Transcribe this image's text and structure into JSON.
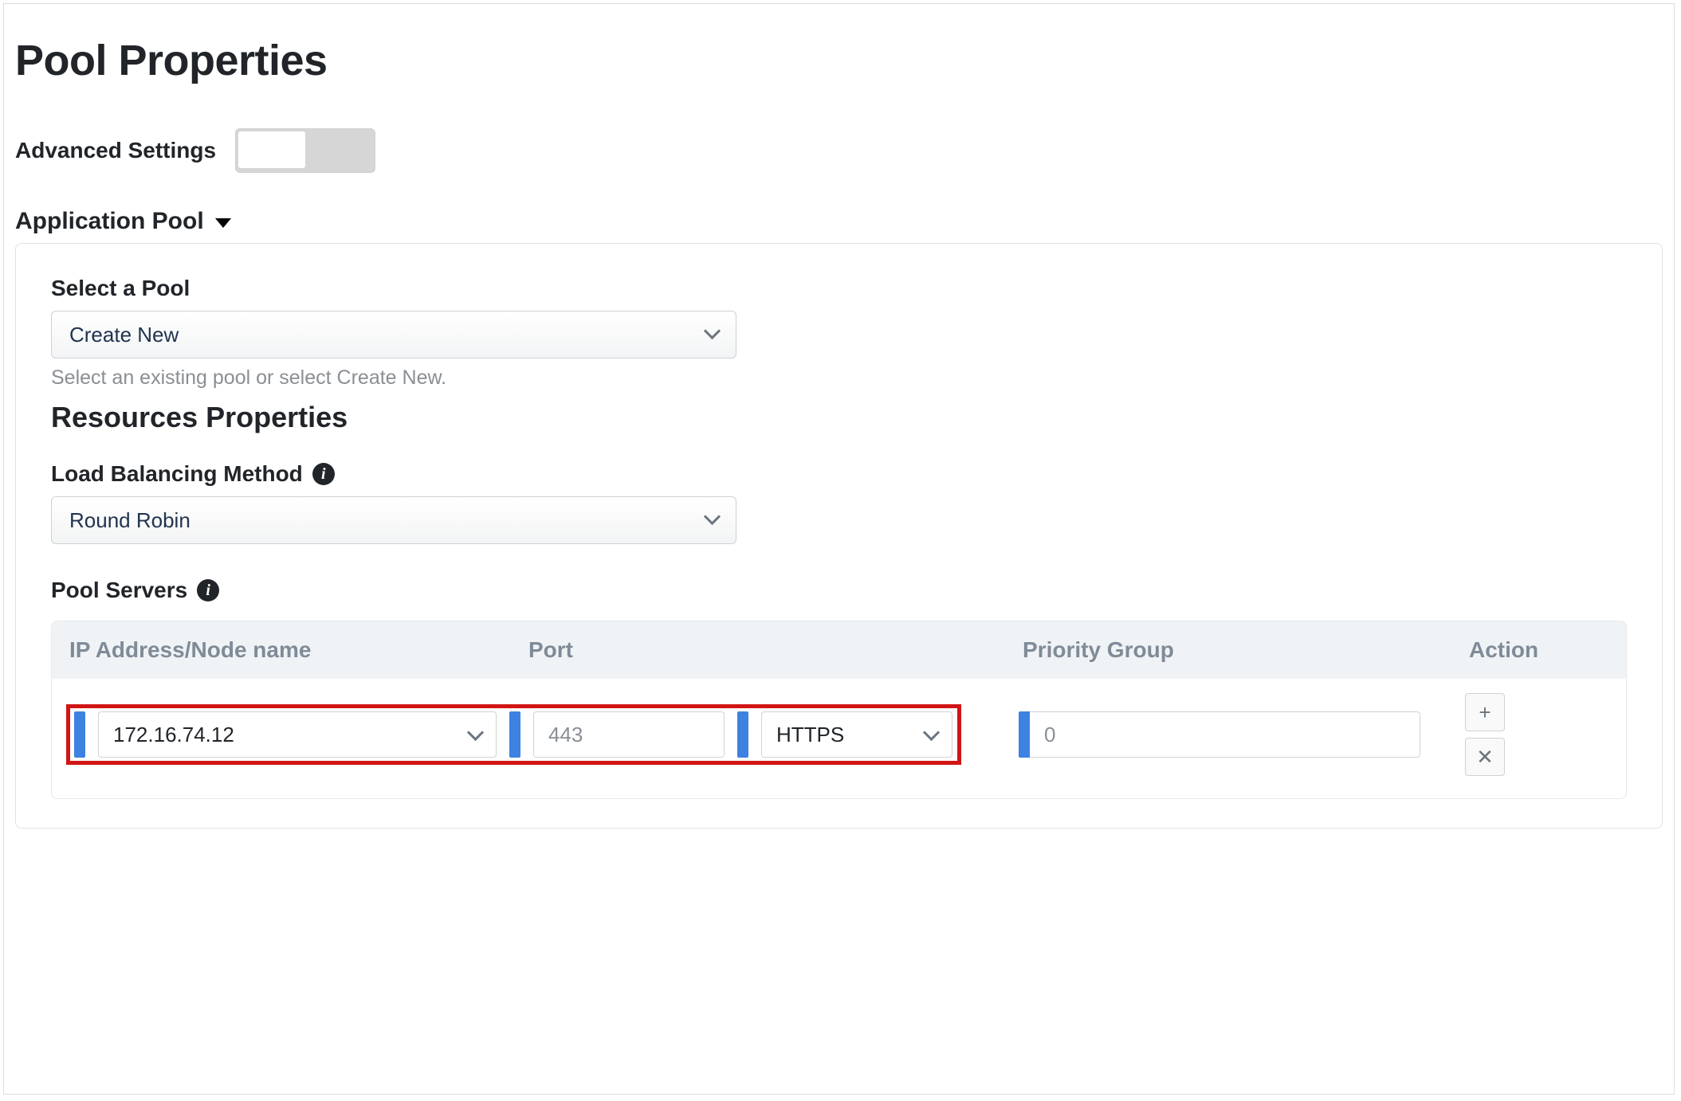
{
  "page_title": "Pool Properties",
  "advanced_settings": {
    "label": "Advanced Settings",
    "enabled": false
  },
  "section": {
    "title": "Application Pool",
    "expanded": true
  },
  "select_pool": {
    "label": "Select a Pool",
    "value": "Create New",
    "helper": "Select an existing pool or select Create New."
  },
  "sub_heading": "Resources Properties",
  "load_balancing": {
    "label": "Load Balancing Method",
    "value": "Round Robin"
  },
  "pool_servers": {
    "label": "Pool Servers",
    "columns": {
      "ip": "IP Address/Node name",
      "port": "Port",
      "priority": "Priority Group",
      "action": "Action"
    },
    "rows": [
      {
        "ip": "172.16.74.12",
        "port": "443",
        "protocol": "HTTPS",
        "priority": "0"
      }
    ]
  },
  "icons": {
    "plus": "+",
    "times": "✕"
  }
}
